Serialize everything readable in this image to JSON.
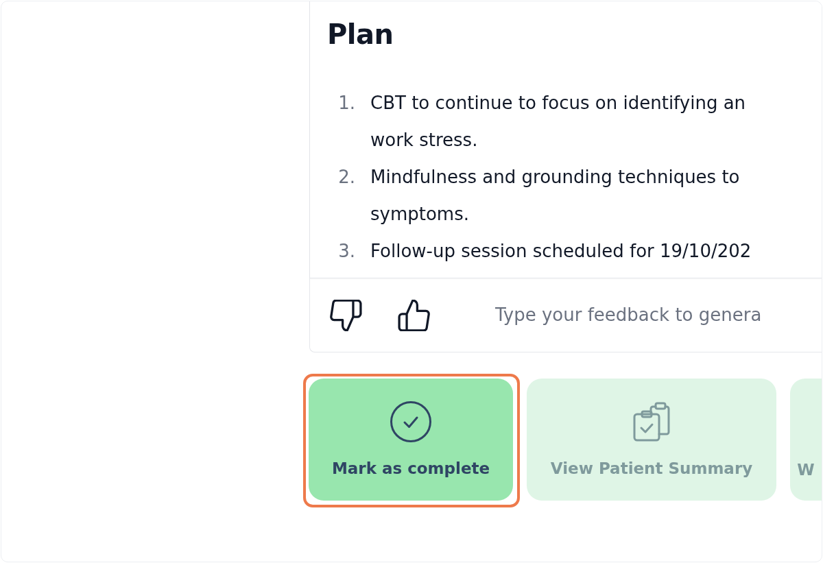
{
  "plan": {
    "title": "Plan",
    "items": [
      {
        "number": "1.",
        "lines": [
          "CBT to continue to focus on identifying an",
          "work stress."
        ]
      },
      {
        "number": "2.",
        "lines": [
          "Mindfulness and grounding techniques to",
          "symptoms."
        ]
      },
      {
        "number": "3.",
        "lines": [
          "Follow-up session scheduled for 19/10/202"
        ]
      }
    ]
  },
  "feedback": {
    "placeholder": "Type your feedback to genera"
  },
  "actions": [
    {
      "kind": "check",
      "label": "Mark as complete",
      "disabled": false,
      "highlighted": true
    },
    {
      "kind": "clipboard",
      "label": "View Patient Summary",
      "disabled": true,
      "highlighted": false
    },
    {
      "kind": "plain",
      "label": "W",
      "disabled": true,
      "highlighted": false
    }
  ]
}
